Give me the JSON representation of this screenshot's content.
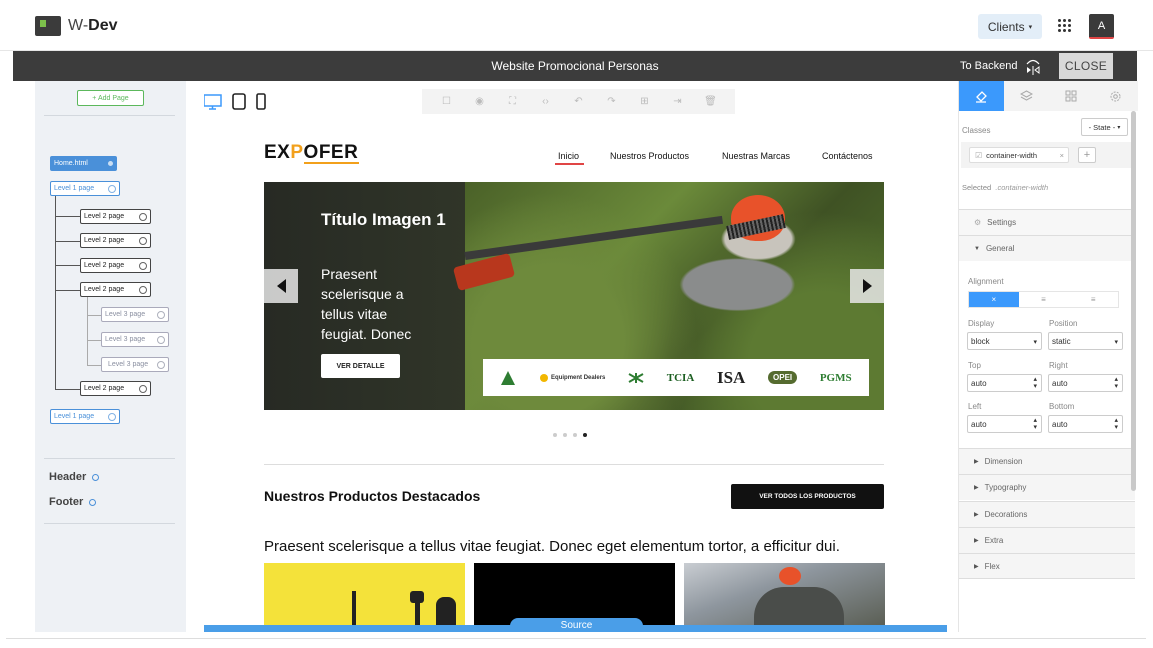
{
  "app": {
    "title_prefix": "W-",
    "title_bold": "Dev",
    "clients_label": "Clients",
    "avatar_initial": "A"
  },
  "editor_bar": {
    "site_title": "Website Promocional Personas",
    "to_backend": "To Backend",
    "close_label": "CLOSE"
  },
  "pages_panel": {
    "add_page": "+ Add Page",
    "tree": [
      {
        "label": "Home.html",
        "level": 0
      },
      {
        "label": "Level 1 page",
        "level": 1
      },
      {
        "label": "Level 2 page",
        "level": 2
      },
      {
        "label": "Level 2 page",
        "level": 2
      },
      {
        "label": "Level 2 page",
        "level": 2
      },
      {
        "label": "Level 2 page",
        "level": 2
      },
      {
        "label": "Level 3 page",
        "level": 3
      },
      {
        "label": "Level 3 page",
        "level": 3
      },
      {
        "label": "Level 3 page",
        "level": 3
      },
      {
        "label": "Level 2 page",
        "level": 2
      },
      {
        "label": "Level 1 page",
        "level": 1
      }
    ],
    "header_label": "Header",
    "footer_label": "Footer"
  },
  "site": {
    "logo_part1": "EX",
    "logo_part2": "P",
    "logo_part3": "OFER",
    "nav": [
      "Inicio",
      "Nuestros Productos",
      "Nuestras Marcas",
      "Contáctenos"
    ],
    "hero": {
      "title": "Título Imagen 1",
      "text": "Praesent scelerisque a tellus vitae feugiat. Donec",
      "button": "VER DETALLE",
      "sponsors": [
        "Equipment Dealers",
        "TCIA",
        "ISA",
        "OPEI",
        "PGMS"
      ],
      "active_slide": 4,
      "slide_count": 4
    },
    "featured_title": "Nuestros Productos Destacados",
    "featured_button": "VER TODOS LOS PRODUCTOS",
    "featured_text": "Praesent scelerisque a tellus vitae feugiat. Donec eget elementum tortor, a efficitur dui."
  },
  "source_label": "Source",
  "style_panel": {
    "classes_label": "Classes",
    "state_label": "- State -",
    "class_tag": "container-width",
    "selected_prefix": "Selected",
    "selected_value": ".container-width",
    "settings_label": "Settings",
    "general_label": "General",
    "alignment_label": "Alignment",
    "display_label": "Display",
    "display_value": "block",
    "position_label": "Position",
    "position_value": "static",
    "top_label": "Top",
    "top_value": "auto",
    "right_label": "Right",
    "right_value": "auto",
    "left_label": "Left",
    "left_value": "auto",
    "bottom_label": "Bottom",
    "bottom_value": "auto",
    "sections": [
      "Dimension",
      "Typography",
      "Decorations",
      "Extra",
      "Flex"
    ]
  },
  "colors": {
    "accent_blue": "#3b99fc",
    "brand_orange": "#f2a01b",
    "nav_active_red": "#e04545",
    "add_page_green": "#5cb85c"
  }
}
